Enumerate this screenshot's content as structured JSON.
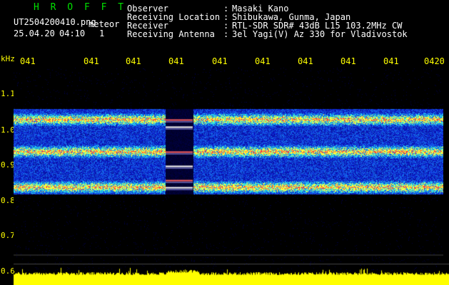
{
  "header": {
    "station_title": "H R O F F T",
    "filename": "UT2504200410.png",
    "meteor_label": "meteor",
    "date": "25.04.20",
    "time": "04:10",
    "meteor_count": "1"
  },
  "meta": [
    {
      "label": "Observer",
      "colon": ":",
      "value": "Masaki Kano"
    },
    {
      "label": "Receiving Location",
      "colon": ":",
      "value": "Shibukawa, Gunma, Japan"
    },
    {
      "label": "Receiver",
      "colon": ":",
      "value": "RTL-SDR SDR# 43dB L15 103.2MHz CW"
    },
    {
      "label": "Receiving Antenna",
      "colon": ":",
      "value": "3el Yagi(V) Az 330 for Vladivostok"
    }
  ],
  "axis": {
    "freq_unit": "kHz",
    "freq_ticks": [
      "1.1",
      "1.0",
      "0.9",
      "0.8",
      "0.7",
      "0.6"
    ],
    "time_ticks": [
      "041",
      "041",
      "041",
      "041",
      "041",
      "041",
      "041",
      "041",
      "041",
      "0420"
    ]
  },
  "colors": {
    "background": "#000000",
    "label_yellow": "#ffff00",
    "title_green": "#00e000",
    "noise_blue": "#1020c0",
    "signal_cyan": "#20c0ff",
    "signal_yellow": "#ffff40",
    "signal_red": "#ff4040",
    "power_yellow": "#ffff00"
  },
  "spectrogram": {
    "band_top_khz": 1.02,
    "band_bottom_khz": 0.78,
    "strong_rows_khz": [
      0.99,
      0.9,
      0.8
    ],
    "meteor_event": {
      "time_index": 3,
      "freq_khz": [
        0.99,
        0.97,
        0.9,
        0.86,
        0.82,
        0.8
      ]
    }
  }
}
